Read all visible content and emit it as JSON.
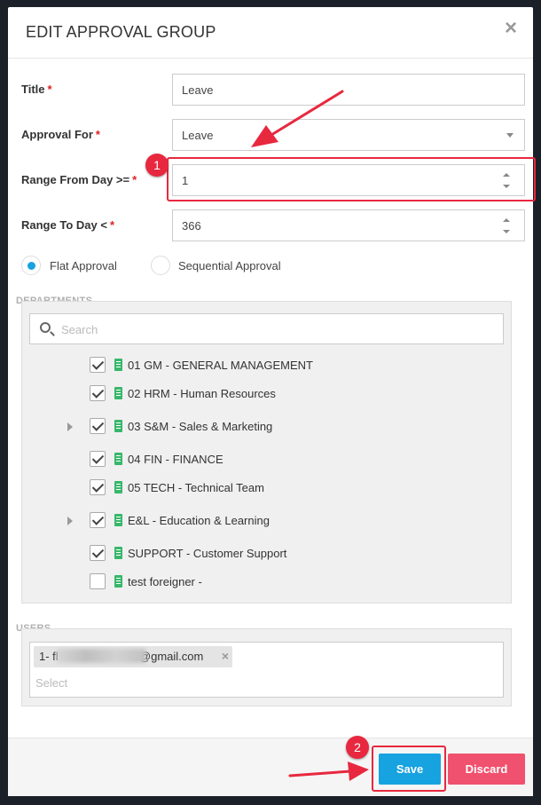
{
  "dialog": {
    "title": "EDIT APPROVAL GROUP",
    "close_glyph": "×"
  },
  "form": {
    "title_label": "Title",
    "title_value": "Leave",
    "approval_for_label": "Approval For",
    "approval_for_value": "Leave",
    "range_from_label": "Range From Day >=",
    "range_from_value": "1",
    "range_to_label": "Range To Day <",
    "range_to_value": "366",
    "required_mark": "*"
  },
  "approval_type": {
    "options": [
      {
        "label": "Flat Approval",
        "selected": true
      },
      {
        "label": "Sequential Approval",
        "selected": false
      }
    ]
  },
  "departments": {
    "legend": "DEPARTMENTS",
    "search_placeholder": "Search",
    "items": [
      {
        "label": "01 GM - GENERAL MANAGEMENT",
        "checked": true,
        "expandable": false
      },
      {
        "label": "02 HRM - Human Resources",
        "checked": true,
        "expandable": false
      },
      {
        "label": "03 S&M - Sales & Marketing",
        "checked": true,
        "expandable": true
      },
      {
        "label": "04 FIN - FINANCE",
        "checked": true,
        "expandable": false
      },
      {
        "label": "05 TECH - Technical Team",
        "checked": true,
        "expandable": false
      },
      {
        "label": "E&L - Education & Learning",
        "checked": true,
        "expandable": true
      },
      {
        "label": "SUPPORT - Customer Support",
        "checked": true,
        "expandable": false
      },
      {
        "label": "test foreigner -",
        "checked": false,
        "expandable": false
      }
    ]
  },
  "users": {
    "legend": "USERS",
    "selected_user_prefix": "1- fl",
    "selected_user_suffix": "3@gmail.com",
    "remove_glyph": "×",
    "placeholder": "Select"
  },
  "footer": {
    "save_label": "Save",
    "discard_label": "Discard"
  },
  "annotations": {
    "step1": "1",
    "step2": "2",
    "color": "#e8283f"
  },
  "colors": {
    "primary": "#17a2e0",
    "danger": "#f0516e",
    "department_icon": "#38b76b"
  }
}
